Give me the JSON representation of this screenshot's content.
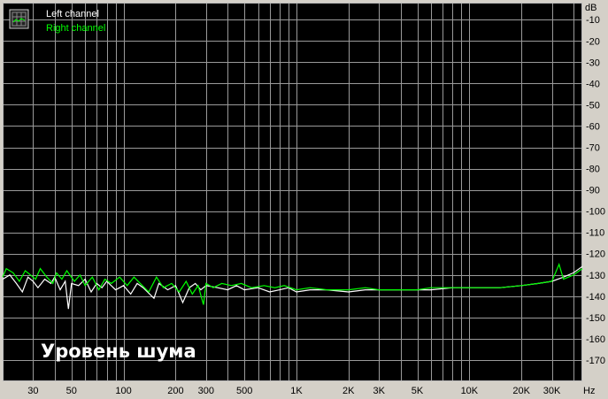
{
  "chart_data": {
    "type": "line",
    "title": "",
    "annotation": "Уровень шума",
    "xlabel_unit": "Hz",
    "ylabel_unit": "dB",
    "x_scale": "log",
    "xlim": [
      20,
      45000
    ],
    "ylim": [
      -180,
      -2
    ],
    "grid": true,
    "legend_placement": "top-left",
    "x_ticks": [
      {
        "v": 30,
        "t": "30"
      },
      {
        "v": 50,
        "t": "50"
      },
      {
        "v": 100,
        "t": "100"
      },
      {
        "v": 200,
        "t": "200"
      },
      {
        "v": 300,
        "t": "300"
      },
      {
        "v": 500,
        "t": "500"
      },
      {
        "v": 1000,
        "t": "1K"
      },
      {
        "v": 2000,
        "t": "2K"
      },
      {
        "v": 3000,
        "t": "3K"
      },
      {
        "v": 5000,
        "t": "5K"
      },
      {
        "v": 10000,
        "t": "10K"
      },
      {
        "v": 20000,
        "t": "20K"
      },
      {
        "v": 30000,
        "t": "30K"
      }
    ],
    "y_ticks": [
      {
        "v": -10,
        "t": "-10"
      },
      {
        "v": -20,
        "t": "-20"
      },
      {
        "v": -30,
        "t": "-30"
      },
      {
        "v": -40,
        "t": "-40"
      },
      {
        "v": -50,
        "t": "-50"
      },
      {
        "v": -60,
        "t": "-60"
      },
      {
        "v": -70,
        "t": "-70"
      },
      {
        "v": -80,
        "t": "-80"
      },
      {
        "v": -90,
        "t": "-90"
      },
      {
        "v": -100,
        "t": "-100"
      },
      {
        "v": -110,
        "t": "-110"
      },
      {
        "v": -120,
        "t": "-120"
      },
      {
        "v": -130,
        "t": "-130"
      },
      {
        "v": -140,
        "t": "-140"
      },
      {
        "v": -150,
        "t": "-150"
      },
      {
        "v": -160,
        "t": "-160"
      },
      {
        "v": -170,
        "t": "-170"
      }
    ],
    "series": [
      {
        "name": "Left channel",
        "color": "#ffffff",
        "points": [
          [
            20,
            -132
          ],
          [
            22,
            -130
          ],
          [
            24,
            -134
          ],
          [
            26,
            -138
          ],
          [
            28,
            -131
          ],
          [
            30,
            -133
          ],
          [
            32,
            -136
          ],
          [
            35,
            -132
          ],
          [
            38,
            -134
          ],
          [
            40,
            -131
          ],
          [
            43,
            -137
          ],
          [
            46,
            -133
          ],
          [
            48,
            -146
          ],
          [
            50,
            -134
          ],
          [
            55,
            -135
          ],
          [
            60,
            -132
          ],
          [
            65,
            -138
          ],
          [
            70,
            -134
          ],
          [
            75,
            -136
          ],
          [
            80,
            -133
          ],
          [
            90,
            -137
          ],
          [
            100,
            -135
          ],
          [
            110,
            -139
          ],
          [
            120,
            -134
          ],
          [
            130,
            -136
          ],
          [
            150,
            -141
          ],
          [
            160,
            -134
          ],
          [
            180,
            -137
          ],
          [
            200,
            -135
          ],
          [
            220,
            -143
          ],
          [
            240,
            -136
          ],
          [
            260,
            -134
          ],
          [
            280,
            -137
          ],
          [
            300,
            -135
          ],
          [
            350,
            -136
          ],
          [
            400,
            -137
          ],
          [
            450,
            -135
          ],
          [
            500,
            -137
          ],
          [
            600,
            -136
          ],
          [
            700,
            -138
          ],
          [
            800,
            -137
          ],
          [
            900,
            -136
          ],
          [
            1000,
            -138
          ],
          [
            1200,
            -137
          ],
          [
            1500,
            -137
          ],
          [
            2000,
            -138
          ],
          [
            2500,
            -137
          ],
          [
            3000,
            -137
          ],
          [
            4000,
            -137
          ],
          [
            5000,
            -137
          ],
          [
            6000,
            -137
          ],
          [
            8000,
            -136
          ],
          [
            10000,
            -136
          ],
          [
            12000,
            -136
          ],
          [
            15000,
            -136
          ],
          [
            20000,
            -135
          ],
          [
            25000,
            -134
          ],
          [
            30000,
            -133
          ],
          [
            35000,
            -131
          ],
          [
            40000,
            -129
          ],
          [
            45000,
            -126
          ]
        ]
      },
      {
        "name": "Right channel",
        "color": "#00ff00",
        "points": [
          [
            20,
            -131
          ],
          [
            21,
            -127
          ],
          [
            23,
            -129
          ],
          [
            25,
            -133
          ],
          [
            27,
            -128
          ],
          [
            29,
            -130
          ],
          [
            31,
            -132
          ],
          [
            33,
            -127
          ],
          [
            36,
            -131
          ],
          [
            39,
            -134
          ],
          [
            41,
            -129
          ],
          [
            44,
            -132
          ],
          [
            47,
            -128
          ],
          [
            52,
            -133
          ],
          [
            56,
            -130
          ],
          [
            60,
            -135
          ],
          [
            66,
            -131
          ],
          [
            72,
            -137
          ],
          [
            78,
            -132
          ],
          [
            85,
            -134
          ],
          [
            95,
            -131
          ],
          [
            105,
            -135
          ],
          [
            115,
            -131
          ],
          [
            125,
            -134
          ],
          [
            140,
            -138
          ],
          [
            155,
            -131
          ],
          [
            170,
            -136
          ],
          [
            190,
            -134
          ],
          [
            210,
            -138
          ],
          [
            230,
            -133
          ],
          [
            250,
            -139
          ],
          [
            270,
            -135
          ],
          [
            290,
            -144
          ],
          [
            300,
            -134
          ],
          [
            330,
            -136
          ],
          [
            370,
            -134
          ],
          [
            420,
            -135
          ],
          [
            480,
            -134
          ],
          [
            550,
            -136
          ],
          [
            650,
            -135
          ],
          [
            750,
            -136
          ],
          [
            850,
            -135
          ],
          [
            1000,
            -137
          ],
          [
            1200,
            -136
          ],
          [
            1500,
            -137
          ],
          [
            2000,
            -137
          ],
          [
            2500,
            -136
          ],
          [
            3000,
            -137
          ],
          [
            4000,
            -137
          ],
          [
            5000,
            -137
          ],
          [
            6000,
            -136
          ],
          [
            8000,
            -136
          ],
          [
            10000,
            -136
          ],
          [
            12000,
            -136
          ],
          [
            15000,
            -136
          ],
          [
            20000,
            -135
          ],
          [
            25000,
            -134
          ],
          [
            30000,
            -133
          ],
          [
            33000,
            -125
          ],
          [
            35000,
            -132
          ],
          [
            40000,
            -130
          ],
          [
            45000,
            -127
          ]
        ]
      }
    ]
  }
}
